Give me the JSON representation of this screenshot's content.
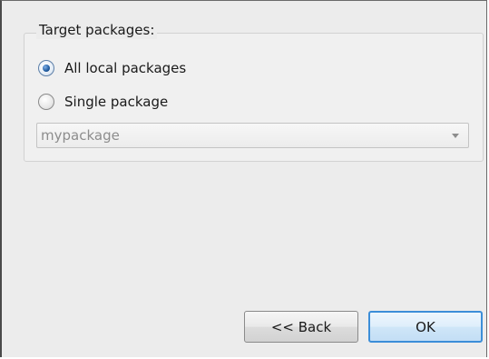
{
  "group": {
    "title": "Target packages:"
  },
  "options": {
    "all_local": {
      "label": "All local packages",
      "checked": true
    },
    "single": {
      "label": "Single package",
      "checked": false
    }
  },
  "package_select": {
    "value": "mypackage",
    "enabled": false
  },
  "buttons": {
    "back_label": "<< Back",
    "ok_label": "OK"
  }
}
